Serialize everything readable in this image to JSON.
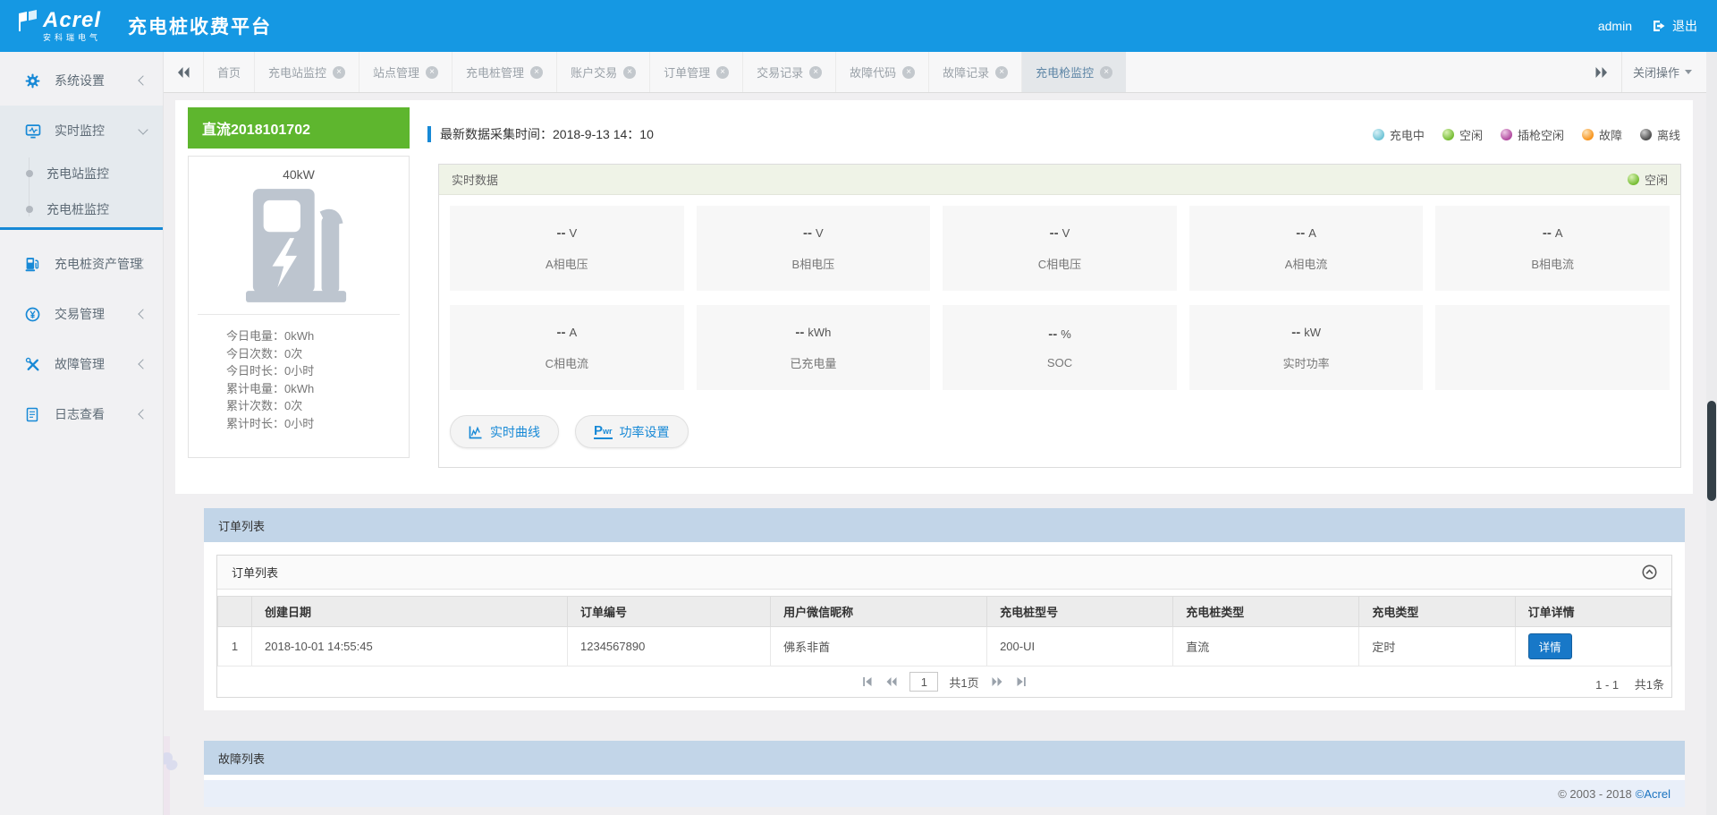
{
  "header": {
    "logo_main": "Acrel",
    "logo_sub": "安科瑞电气",
    "title": "充电桩收费平台",
    "username": "admin",
    "logout_label": "退出"
  },
  "sidebar": {
    "items": [
      {
        "label": "系统设置",
        "icon": "gear-icon"
      },
      {
        "label": "实时监控",
        "icon": "monitor-icon",
        "expanded": true,
        "children": [
          {
            "label": "充电站监控"
          },
          {
            "label": "充电桩监控"
          }
        ]
      },
      {
        "label": "充电桩资产管理",
        "icon": "charging-pile-icon"
      },
      {
        "label": "交易管理",
        "icon": "yuan-circle-icon"
      },
      {
        "label": "故障管理",
        "icon": "tools-icon"
      },
      {
        "label": "日志查看",
        "icon": "log-icon"
      }
    ]
  },
  "tabbar": {
    "tabs": [
      {
        "label": "首页",
        "closable": false
      },
      {
        "label": "充电站监控",
        "closable": true
      },
      {
        "label": "站点管理",
        "closable": true
      },
      {
        "label": "充电桩管理",
        "closable": true
      },
      {
        "label": "账户交易",
        "closable": true
      },
      {
        "label": "订单管理",
        "closable": true
      },
      {
        "label": "交易记录",
        "closable": true
      },
      {
        "label": "故障代码",
        "closable": true
      },
      {
        "label": "故障记录",
        "closable": true
      },
      {
        "label": "充电枪监控",
        "closable": true,
        "active": true
      }
    ],
    "close_menu_label": "关闭操作"
  },
  "device_card": {
    "title": "直流2018101702",
    "power_rating": "40kW",
    "stats": [
      {
        "label": "今日电量：",
        "value": "0kWh"
      },
      {
        "label": "今日次数：",
        "value": "0次"
      },
      {
        "label": "今日时长：",
        "value": "0小时"
      },
      {
        "label": "累计电量：",
        "value": "0kWh"
      },
      {
        "label": "累计次数：",
        "value": "0次"
      },
      {
        "label": "累计时长：",
        "value": "0小时"
      }
    ]
  },
  "monitor": {
    "collect_time": "最新数据采集时间：2018-9-13 14：10",
    "legend": [
      {
        "label": "充电中",
        "color": "#6fc4d6"
      },
      {
        "label": "空闲",
        "color": "#77bd35"
      },
      {
        "label": "插枪空闲",
        "color": "#b14a9f"
      },
      {
        "label": "故障",
        "color": "#f7941d"
      },
      {
        "label": "离线",
        "color": "#4c4c4c"
      }
    ],
    "panel": {
      "title": "实时数据",
      "status": {
        "label": "空闲",
        "color": "#77bd35"
      },
      "tiles": [
        {
          "value": "--",
          "unit": "V",
          "label": "A相电压"
        },
        {
          "value": "--",
          "unit": "V",
          "label": "B相电压"
        },
        {
          "value": "--",
          "unit": "V",
          "label": "C相电压"
        },
        {
          "value": "--",
          "unit": "A",
          "label": "A相电流"
        },
        {
          "value": "--",
          "unit": "A",
          "label": "B相电流"
        },
        {
          "value": "--",
          "unit": "A",
          "label": "C相电流"
        },
        {
          "value": "--",
          "unit": "kWh",
          "label": "已充电量"
        },
        {
          "value": "--",
          "unit": "%",
          "label": "SOC"
        },
        {
          "value": "--",
          "unit": "kW",
          "label": "实时功率"
        }
      ],
      "buttons": [
        {
          "label": "实时曲线",
          "icon": "curve-icon"
        },
        {
          "label": "功率设置",
          "icon": "pwr-icon"
        }
      ]
    }
  },
  "orders": {
    "section_title": "订单列表",
    "panel_title": "订单列表",
    "table": {
      "columns": [
        "创建日期",
        "订单编号",
        "用户微信昵称",
        "充电桩型号",
        "充电桩类型",
        "充电类型",
        "订单详情"
      ],
      "rows": [
        {
          "index": "1",
          "created": "2018-10-01 14:55:45",
          "order_no": "1234567890",
          "nickname": "佛系非酋",
          "model": "200-UI",
          "pile_type": "直流",
          "charge_type": "定时",
          "detail_label": "详情"
        }
      ]
    },
    "pagination": {
      "page": "1",
      "pages_label": "共1页",
      "range": "1 - 1",
      "total": "共1条"
    }
  },
  "faults": {
    "section_title": "故障列表"
  },
  "footer": {
    "copy_prefix": "© 2003 - 2018",
    "brand": "©Acrel"
  }
}
